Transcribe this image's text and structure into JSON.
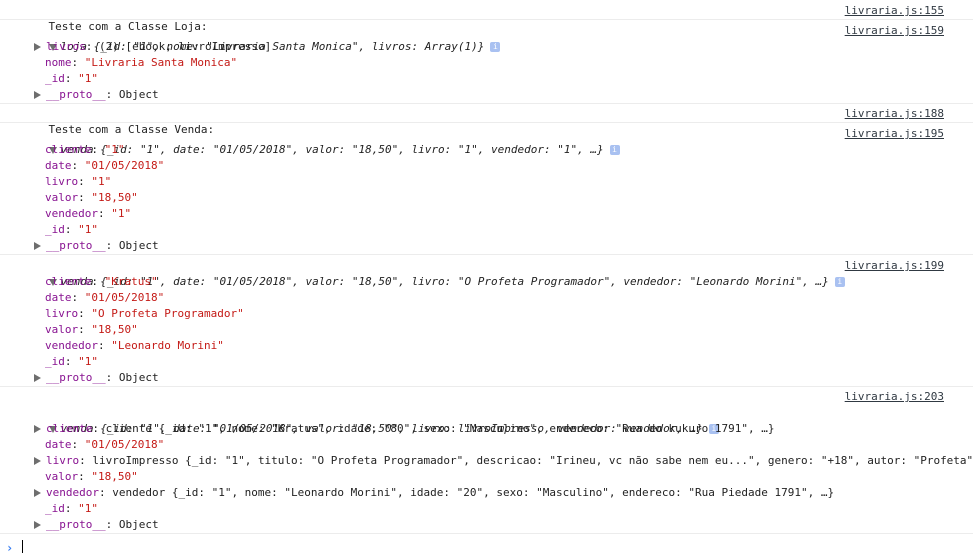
{
  "messages": [
    {
      "id": "m1",
      "header": "Teste com a Classe Loja:",
      "source": "livraria.js:155"
    },
    {
      "id": "m2",
      "source": "livraria.js:159",
      "summary_name": "loja",
      "summary": "{_id: \"1\", nome: \"Livraria Santa Monica\", livros: Array(1)}",
      "props": [
        {
          "key": "livros",
          "value": "(2) [ebook, livroImpresso]",
          "expandable": true
        },
        {
          "key": "nome",
          "value": "\"Livraria Santa Monica\""
        },
        {
          "key": "_id",
          "value": "\"1\""
        },
        {
          "key": "__proto__",
          "value": "Object",
          "expandable": true
        }
      ]
    },
    {
      "id": "m3",
      "header": "Teste com a Classe Venda:",
      "source": "livraria.js:188"
    },
    {
      "id": "m4",
      "source": "livraria.js:195",
      "summary_name": "venda",
      "summary": "{_id: \"1\", date: \"01/05/2018\", valor: \"18,50\", livro: \"1\", vendedor: \"1\", …}",
      "props": [
        {
          "key": "cliente",
          "value": "\"1\""
        },
        {
          "key": "date",
          "value": "\"01/05/2018\""
        },
        {
          "key": "livro",
          "value": "\"1\""
        },
        {
          "key": "valor",
          "value": "\"18,50\""
        },
        {
          "key": "vendedor",
          "value": "\"1\""
        },
        {
          "key": "_id",
          "value": "\"1\""
        },
        {
          "key": "__proto__",
          "value": "Object",
          "expandable": true
        }
      ]
    },
    {
      "id": "m5",
      "source": "livraria.js:199",
      "summary_name": "venda",
      "summary": "{_id: \"1\", date: \"01/05/2018\", valor: \"18,50\", livro: \"O Profeta Programador\", vendedor: \"Leonardo Morini\", …}",
      "props": [
        {
          "key": "cliente",
          "value": "\"Kratus\""
        },
        {
          "key": "date",
          "value": "\"01/05/2018\""
        },
        {
          "key": "livro",
          "value": "\"O Profeta Programador\""
        },
        {
          "key": "valor",
          "value": "\"18,50\""
        },
        {
          "key": "vendedor",
          "value": "\"Leonardo Morini\""
        },
        {
          "key": "_id",
          "value": "\"1\""
        },
        {
          "key": "__proto__",
          "value": "Object",
          "expandable": true
        }
      ]
    },
    {
      "id": "m6",
      "source": "livraria.js:203",
      "summary_name": "venda",
      "summary": "{_id: \"1\", date: \"01/05/2018\", valor: \"18,50\", livro: livroImpresso, vendedor: vendedor, …}",
      "props": [
        {
          "key": "cliente",
          "value": "cliente {_id: \"1\", nome: \"Kratus\", idade: \"80\", sexo: \"Masculino\", endereco: \"Rua do kukuro 1791\", …}",
          "expandable": true
        },
        {
          "key": "date",
          "value": "\"01/05/2018\""
        },
        {
          "key": "livro",
          "value": "livroImpresso {_id: \"1\", titulo: \"O Profeta Programador\", descricao: \"Irineu, vc não sabe nem eu...\", genero: \"+18\", autor: \"Profeta\"",
          "expandable": true
        },
        {
          "key": "valor",
          "value": "\"18,50\""
        },
        {
          "key": "vendedor",
          "value": "vendedor {_id: \"1\", nome: \"Leonardo Morini\", idade: \"20\", sexo: \"Masculino\", endereco: \"Rua Piedade 1791\", …}",
          "expandable": true
        },
        {
          "key": "_id",
          "value": "\"1\""
        },
        {
          "key": "__proto__",
          "value": "Object",
          "expandable": true
        }
      ]
    }
  ],
  "info_badge": "i",
  "prompt_symbol": "›",
  "colors": {
    "key": "#881391",
    "string": "#c41a16",
    "link": "#303942",
    "badge": "#a9c1f1",
    "prompt": "#367cf1"
  }
}
